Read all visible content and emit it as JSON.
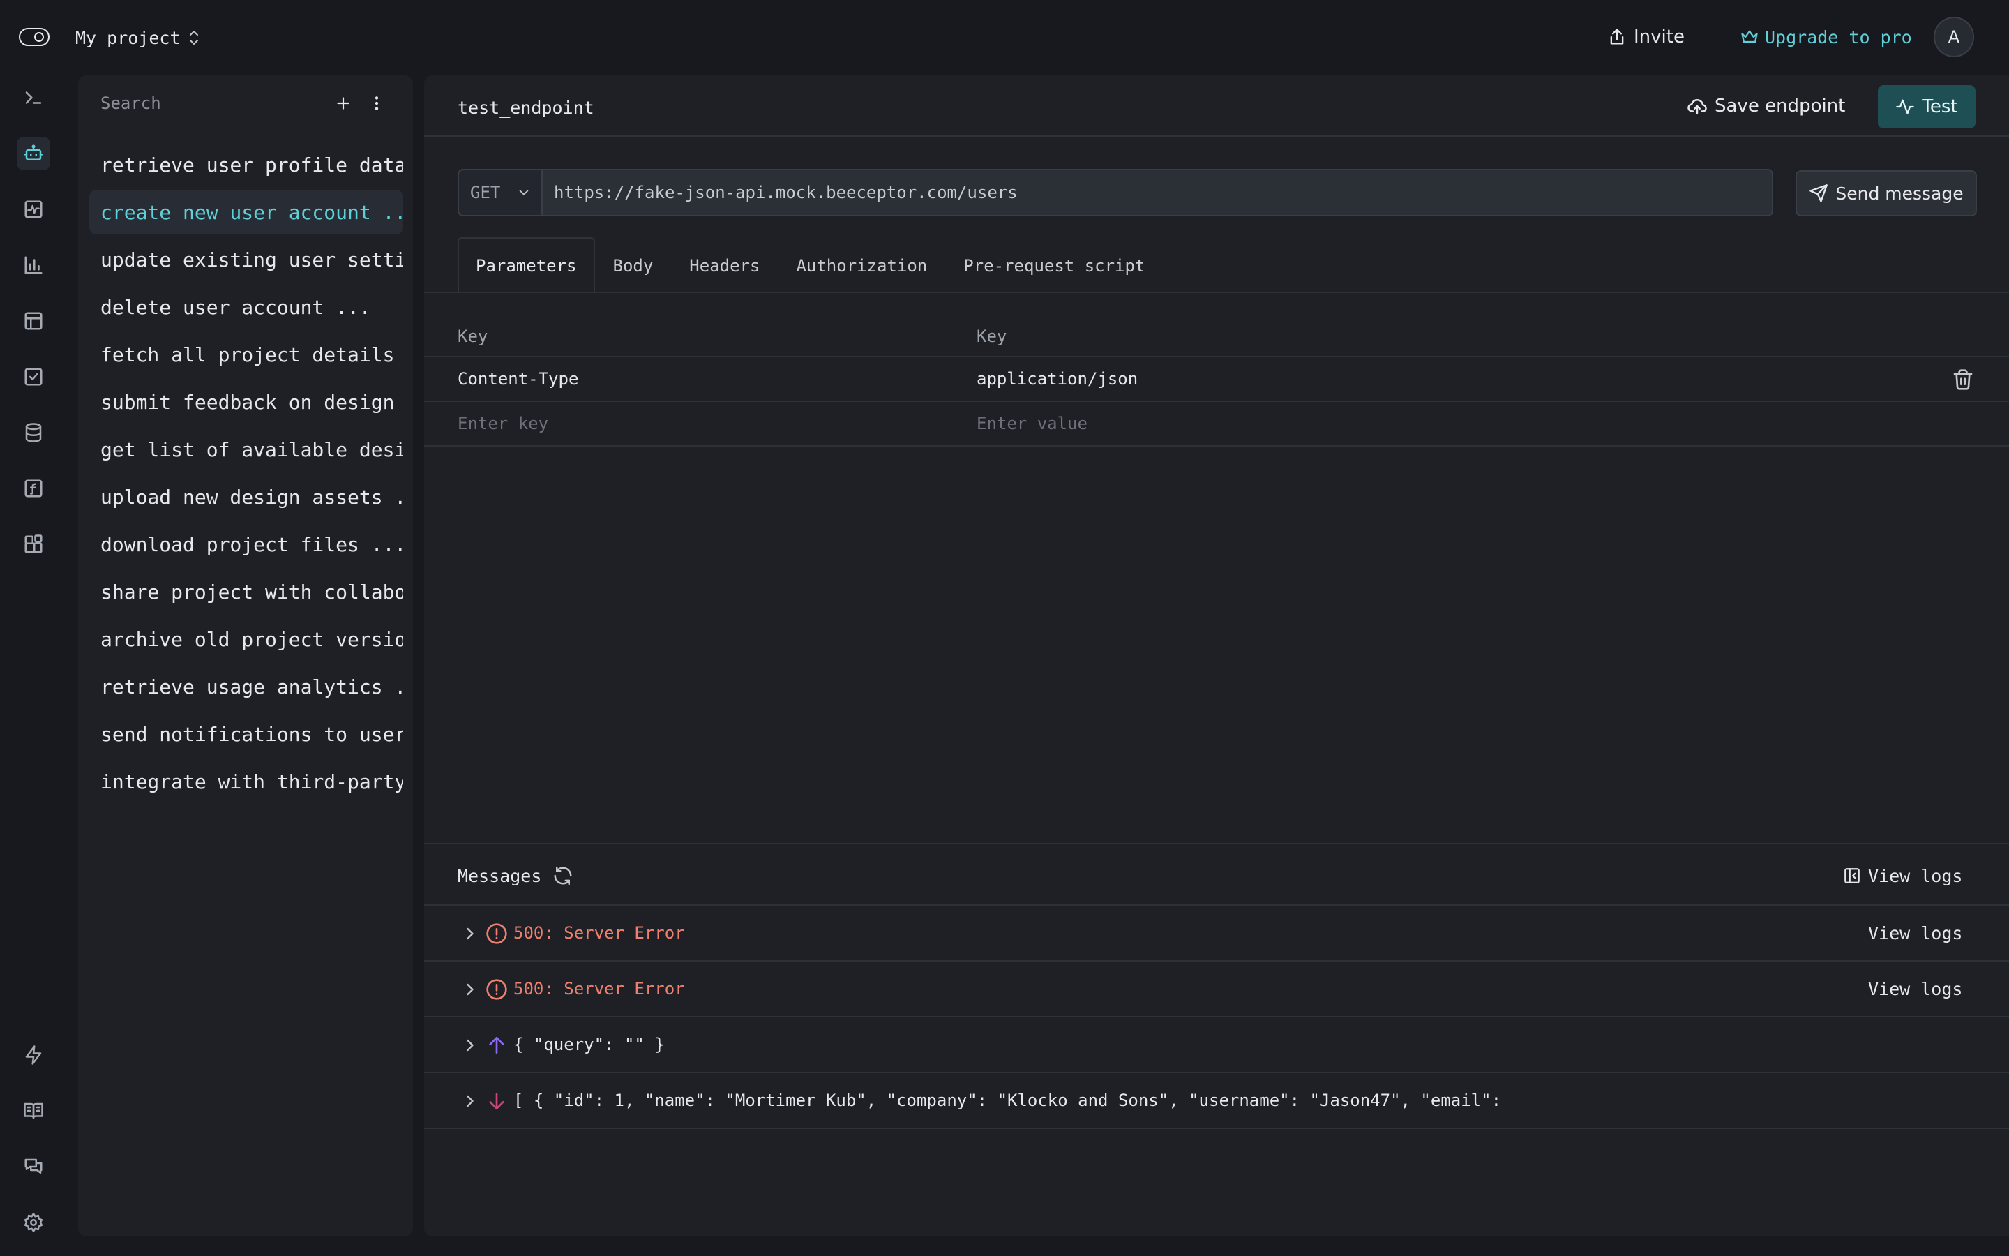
{
  "topbar": {
    "project_name": "My project",
    "invite_label": "Invite",
    "upgrade_label": "Upgrade to pro",
    "avatar_initial": "A"
  },
  "rail": {
    "items": [
      "terminal-icon",
      "bot-icon",
      "activity-icon",
      "bar-chart-icon",
      "table-icon",
      "checkbox-icon",
      "database-icon",
      "function-icon",
      "blocks-icon"
    ],
    "bottom_items": [
      "zap-icon",
      "book-icon",
      "chat-icon",
      "settings-icon"
    ],
    "active": "bot-icon"
  },
  "list": {
    "search_placeholder": "Search",
    "items": [
      "retrieve user profile data",
      "create new user account ...",
      "update existing user settings",
      "delete user account ...",
      "fetch all project details ...",
      "submit feedback on design ...",
      "get list of available designs",
      "upload new design assets ...",
      "download project files ...",
      "share project with collaborators",
      "archive old project versions",
      "retrieve usage analytics ...",
      "send notifications to users",
      "integrate with third-party"
    ],
    "selected_index": 1
  },
  "endpoint": {
    "name": "test_endpoint",
    "save_label": "Save endpoint",
    "test_label": "Test",
    "method": "GET",
    "url": "https://fake-json-api.mock.beeceptor.com/users",
    "send_label": "Send message"
  },
  "tabs": [
    "Parameters",
    "Body",
    "Headers",
    "Authorization",
    "Pre-request script"
  ],
  "active_tab": "Parameters",
  "params": {
    "header_key": "Key",
    "header_value": "Key",
    "rows": [
      {
        "key": "Content-Type",
        "value": "application/json"
      }
    ],
    "placeholder_key": "Enter key",
    "placeholder_value": "Enter value"
  },
  "messages": {
    "title": "Messages",
    "view_logs_label": "View logs",
    "items": [
      {
        "type": "error",
        "text": "500: Server Error",
        "logs": "View logs"
      },
      {
        "type": "error",
        "text": "500: Server Error",
        "logs": "View logs"
      },
      {
        "type": "sent",
        "text": "{ \"query\": \"\" }"
      },
      {
        "type": "received",
        "text": "[ { \"id\": 1, \"name\": \"Mortimer Kub\", \"company\": \"Klocko and Sons\", \"username\": \"Jason47\", \"email\":"
      }
    ]
  },
  "colors": {
    "accent": "#5fcfd8",
    "error": "#ef7f6e",
    "sent_arrow": "#8b6cf0",
    "received_arrow": "#d0417d",
    "test_button": "#1d4f55"
  }
}
